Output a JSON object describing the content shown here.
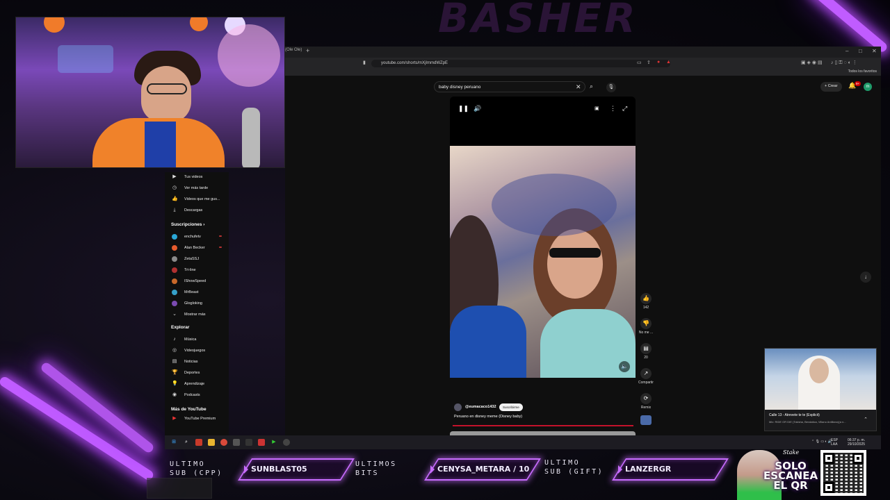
{
  "overlay": {
    "brand": "BASHER",
    "last_sub_label": "ULTIMO\nSUB (CPP)",
    "last_sub_name": "SUNBLAST05",
    "last_bits_label": "ULTIMOS\nBITS",
    "last_bits_name": "CENYSA_METARA / 10",
    "last_gift_label": "ULTIMO\nSUB (GIFT)",
    "last_gift_name": "LANZERGR",
    "qr_brand": "Stake",
    "qr_text": "SOLO\nESCANEA\nEL QR",
    "accent": "#c86cff"
  },
  "browser": {
    "tab_fragment": "(Ole Ole)",
    "url": "youtube.com/shorts/mXjImmdWZpE",
    "bookmarks_all": "Todos los favoritos",
    "minimize": "–",
    "maximize": "□",
    "close": "✕"
  },
  "youtube": {
    "search_value": "baby disney peruano",
    "create_label": "+ Crear",
    "notif_count": "9+",
    "avatar_letter": "m",
    "sidebar": {
      "you_items": [
        {
          "icon": "▶",
          "label": "Tus videos"
        },
        {
          "icon": "◷",
          "label": "Ver más tarde"
        },
        {
          "icon": "👍",
          "label": "Videos que me gus..."
        },
        {
          "icon": "⤓",
          "label": "Descargas"
        }
      ],
      "subs_header": "Suscripciones  ›",
      "subs": [
        {
          "label": "enchufetv",
          "color": "#2aa7d6",
          "dot": true
        },
        {
          "label": "Alan Becker",
          "color": "#e65b2d",
          "dot": true
        },
        {
          "label": "ZetaSSJ",
          "color": "#8a8a8a",
          "dot": false
        },
        {
          "label": "Tri-line",
          "color": "#b03030",
          "dot": false
        },
        {
          "label": "IShowSpeed",
          "color": "#c8682a",
          "dot": false
        },
        {
          "label": "MrBeast",
          "color": "#35a0c8",
          "dot": false
        },
        {
          "label": "Glogloking",
          "color": "#7a4ab0",
          "dot": false
        }
      ],
      "show_more": "Mostrar más",
      "explore_header": "Explorar",
      "explore": [
        {
          "icon": "♪",
          "label": "Música"
        },
        {
          "icon": "◎",
          "label": "Videojuegos"
        },
        {
          "icon": "▤",
          "label": "Noticias"
        },
        {
          "icon": "🏆",
          "label": "Deportes"
        },
        {
          "icon": "💡",
          "label": "Aprendizaje"
        },
        {
          "icon": "◉",
          "label": "Podcasts"
        }
      ],
      "more_header": "Más de YouTube",
      "premium": "YouTube Premium"
    },
    "short": {
      "likes": "142",
      "dislike": "No me ...",
      "comments": "20",
      "share": "Compartir",
      "remix": "Remix",
      "channel": "@eumacaco1432",
      "subscribe": "Suscribirme",
      "title": "Peruano en disney meme (Disney baby)",
      "progress": 1.0
    },
    "music": {
      "song": "Calle 13 - Atrevete te te (Explicit)",
      "sub": "Mix: RIDE OR DIE (Tokisha, Bevdatica, Villano Antillano)(a n..."
    }
  },
  "taskbar": {
    "lang": "ESP\nLAA",
    "time": "06:37 p. m.\n29/10/2025"
  }
}
